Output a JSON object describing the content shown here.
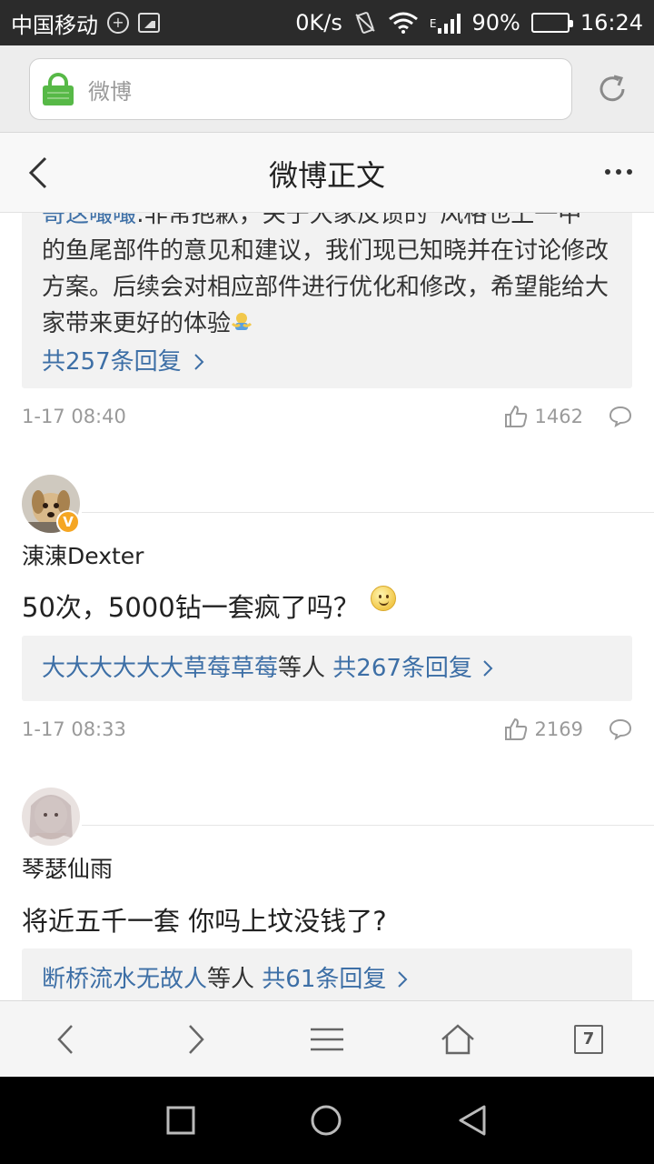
{
  "status_bar": {
    "carrier": "中国移动",
    "net_speed": "0K/s",
    "network_type": "E",
    "battery_percent": "90%",
    "battery_level": 0.9,
    "time": "16:24"
  },
  "address_bar": {
    "url_text": "微博"
  },
  "header": {
    "title": "微博正文"
  },
  "comments": [
    {
      "id": "c0",
      "reply_preview": {
        "partial_top_user": "哥这嘬嘬",
        "partial_top_text": ":非常抱歉，关于大家反馈的“风格也上一中",
        "text": "的鱼尾部件的意见和建议，我们现已知晓并在讨论修改方案。后续会对相应部件进行优化和修改，希望能给大家带来更好的体验",
        "count_link": "共257条回复"
      },
      "time": "1-17 08:40",
      "likes": "1462"
    },
    {
      "id": "c1",
      "user": "涷涷Dexter",
      "verified": "V",
      "text": "50次，5000钻一套疯了吗？",
      "reply_preview": {
        "users": "大大大大大大草莓草莓",
        "suffix": "等人",
        "count_link": "共267条回复"
      },
      "time": "1-17 08:33",
      "likes": "2169"
    },
    {
      "id": "c2",
      "user": "琴瑟仙雨",
      "text": "将近五千一套 你吗上坟没钱了?",
      "reply_preview": {
        "users": "断桥流水无故人",
        "suffix": "等人",
        "count_link": "共61条回复"
      }
    }
  ],
  "toolbar": {
    "tabs_count": "7"
  },
  "colors": {
    "link_blue": "#3d6fa6",
    "lock_green": "#57b947",
    "verified_orange": "#f5a623"
  }
}
